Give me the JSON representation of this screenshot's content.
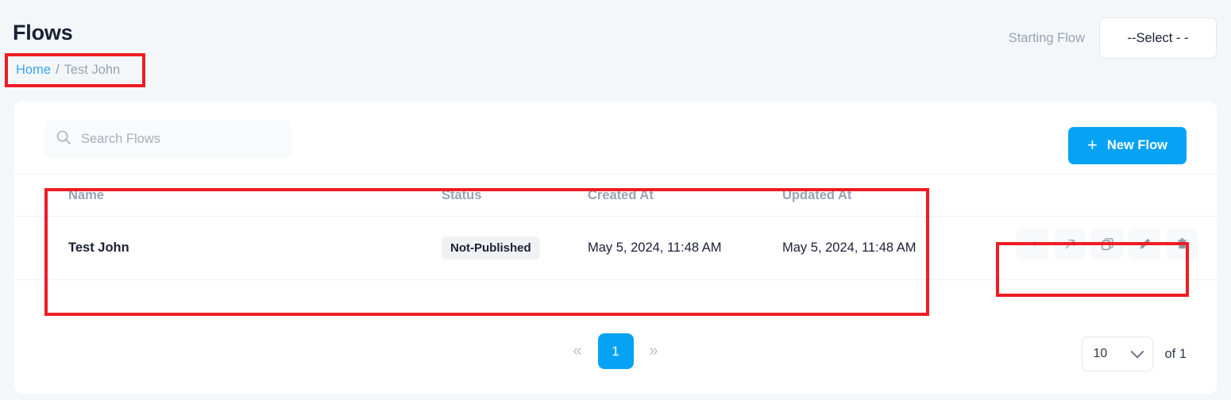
{
  "header": {
    "title": "Flows",
    "breadcrumb": {
      "home": "Home",
      "separator": "/",
      "current": "Test John"
    },
    "starting_flow": {
      "label": "Starting Flow",
      "selected": "--Select - -"
    }
  },
  "toolbar": {
    "search_placeholder": "Search Flows",
    "search_value": "",
    "search_icon": "search-icon",
    "new_flow_label": "New Flow",
    "new_flow_icon": "plus-icon"
  },
  "table": {
    "columns": [
      "Name",
      "Status",
      "Created At",
      "Updated At"
    ],
    "rows": [
      {
        "name": "Test John",
        "status": "Not-Published",
        "created_at": "May 5, 2024, 11:48 AM",
        "updated_at": "May 5, 2024, 11:48 AM",
        "actions": [
          {
            "name": "arrow-right-icon",
            "title": "Go"
          },
          {
            "name": "arrow-up-right-icon",
            "title": "Open"
          },
          {
            "name": "copy-icon",
            "title": "Duplicate"
          },
          {
            "name": "pencil-icon",
            "title": "Edit"
          },
          {
            "name": "trash-icon",
            "title": "Delete"
          }
        ]
      }
    ]
  },
  "pagination": {
    "prev_label": "«",
    "next_label": "»",
    "current_page": "1",
    "page_size": "10",
    "total_label": "of 1"
  },
  "colors": {
    "accent": "#06a3f5",
    "page_background": "#f4f7fa",
    "card_background": "#ffffff",
    "text_primary": "#1a2035",
    "text_muted": "#9aa2b1",
    "link": "#37a6f5",
    "annotation": "#ee1c23",
    "badge_background": "#f1f2f5"
  }
}
